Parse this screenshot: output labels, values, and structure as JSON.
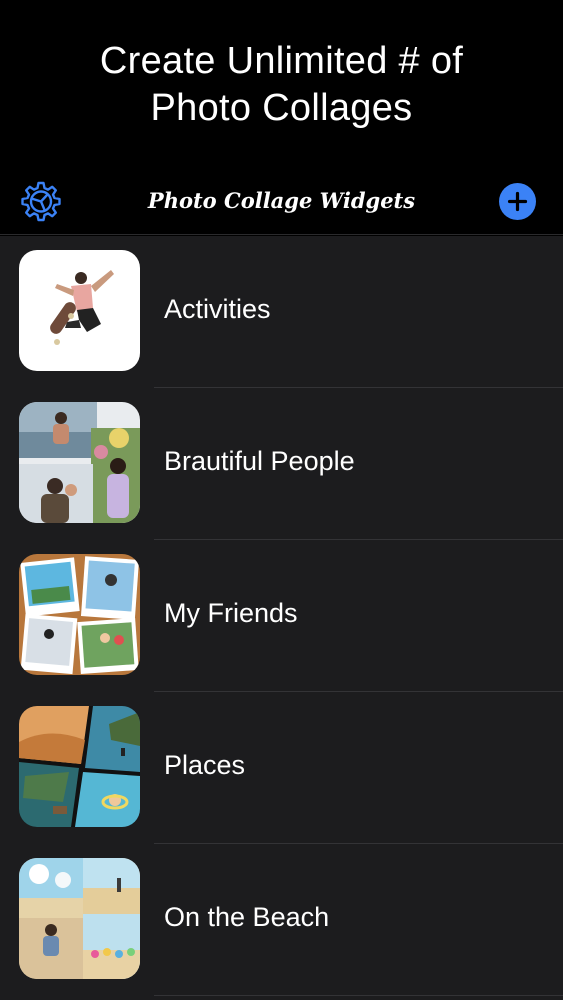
{
  "promo": {
    "line1": "Create Unlimited # of",
    "line2": "Photo Collages"
  },
  "navbar": {
    "title": "Photo Collage Widgets",
    "left_icon": "gear-icon",
    "right_icon": "plus-circle-icon",
    "accent_color": "#3b82f6"
  },
  "collages": [
    {
      "label": "Activities",
      "thumbnail": "skateboarder-jump-photo"
    },
    {
      "label": "Brautiful People",
      "thumbnail": "portraits-collage"
    },
    {
      "label": "My Friends",
      "thumbnail": "polaroid-friends-collage"
    },
    {
      "label": "Places",
      "thumbnail": "landscapes-collage"
    },
    {
      "label": "On the Beach",
      "thumbnail": "beach-collage"
    }
  ]
}
